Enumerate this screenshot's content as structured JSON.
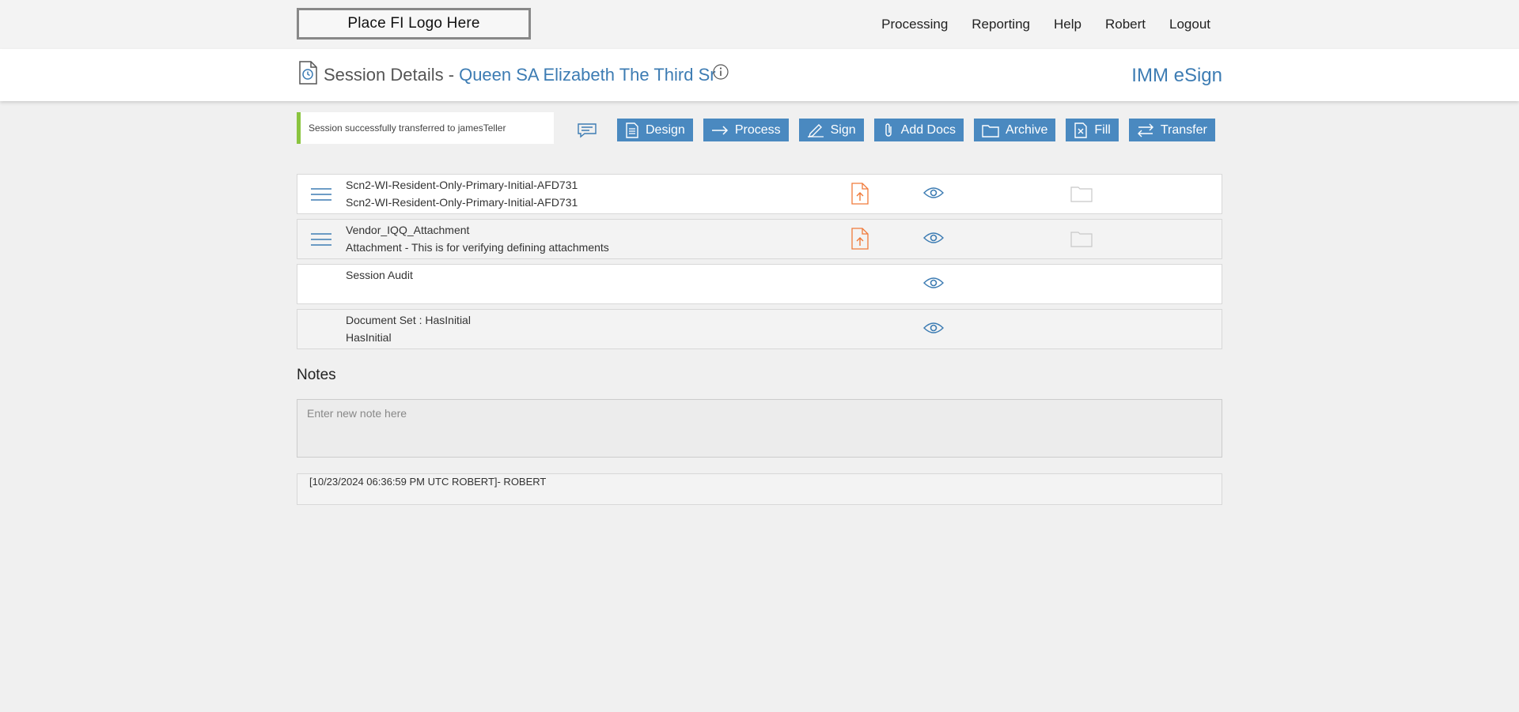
{
  "topbar": {
    "logo_text": "Place FI Logo Here",
    "nav": [
      "Processing",
      "Reporting",
      "Help",
      "Robert",
      "Logout"
    ]
  },
  "header": {
    "title": "Session Details -",
    "session_name": "Queen SA Elizabeth The Third Sr",
    "brand": "IMM eSign"
  },
  "alert": {
    "message": "Session successfully transferred to jamesTeller"
  },
  "toolbar": {
    "design": "Design",
    "process": "Process",
    "sign": "Sign",
    "add_docs": "Add Docs",
    "archive": "Archive",
    "fill": "Fill",
    "transfer": "Transfer"
  },
  "documents": [
    {
      "line1": "Scn2-WI-Resident-Only-Primary-Initial-AFD731",
      "line2": "Scn2-WI-Resident-Only-Primary-Initial-AFD731"
    },
    {
      "line1": "Vendor_IQQ_Attachment",
      "line2": "Attachment - This is for verifying defining attachments"
    },
    {
      "line1": "Session Audit",
      "line2": ""
    },
    {
      "line1": "Document Set : HasInitial",
      "line2": "HasInitial"
    }
  ],
  "notes": {
    "title": "Notes",
    "placeholder": "Enter new note here",
    "entries": [
      "[10/23/2024 06:36:59 PM UTC ROBERT]- ROBERT"
    ]
  },
  "colors": {
    "accent": "#4a89c0",
    "link": "#3d7cb3",
    "success": "#8ac43f",
    "upload": "#f07a3a"
  }
}
